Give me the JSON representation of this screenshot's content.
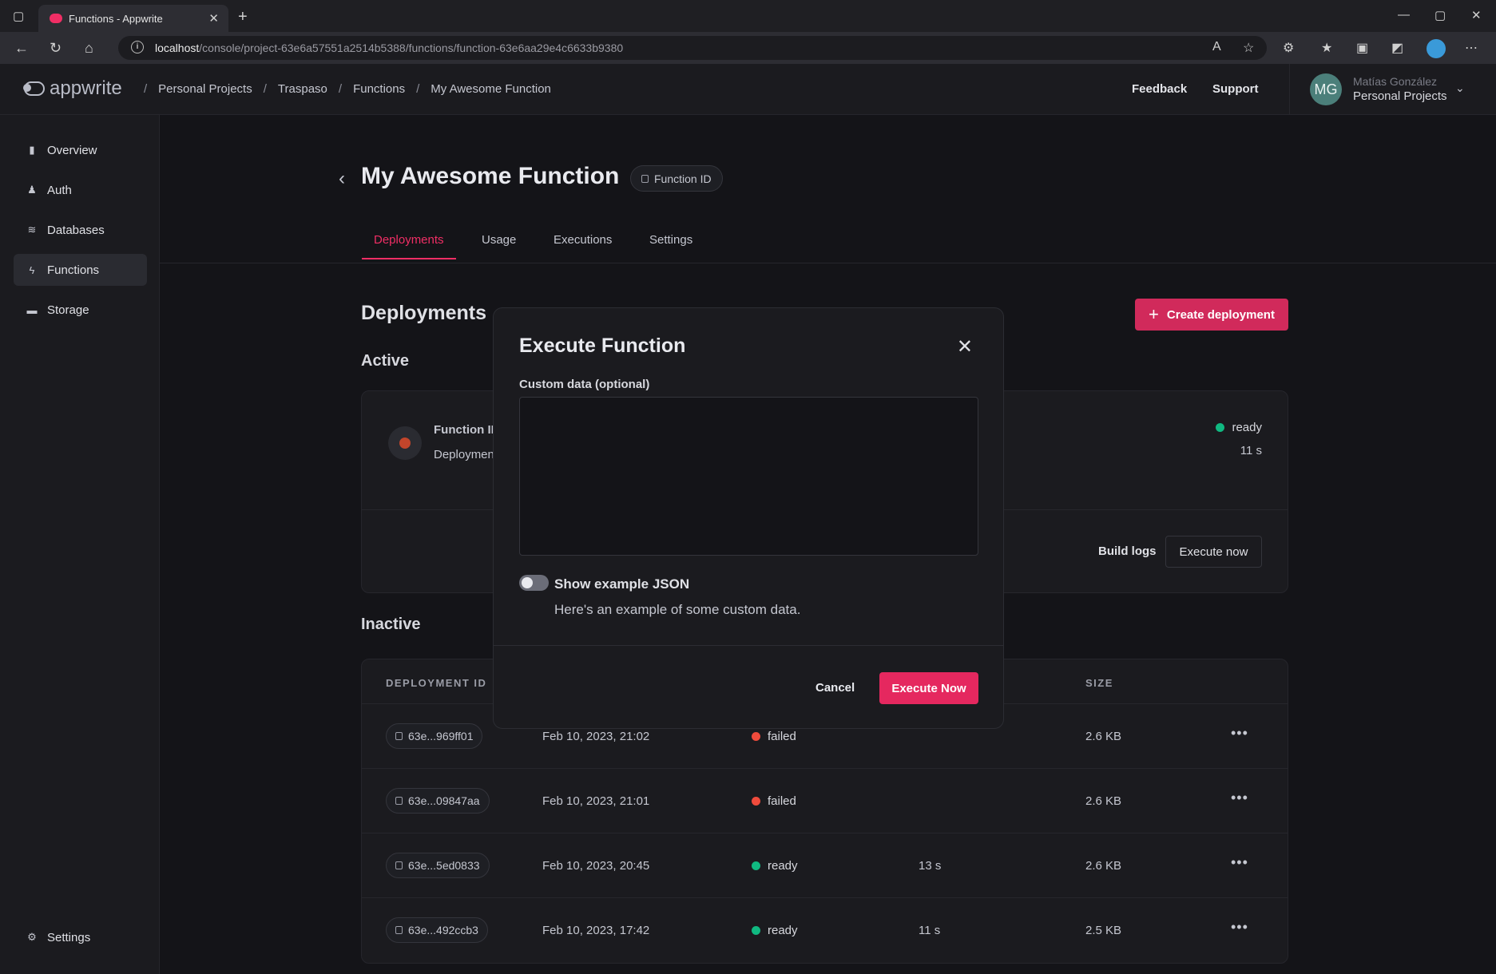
{
  "browser": {
    "tab_title": "Functions - Appwrite",
    "url_host": "localhost",
    "url_path": "/console/project-63e6a57551a2514b5388/functions/function-63e6aa29e4c6633b9380"
  },
  "header": {
    "logo": "appwrite",
    "breadcrumb": [
      "Personal Projects",
      "Traspaso",
      "Functions",
      "My Awesome Function"
    ],
    "feedback": "Feedback",
    "support": "Support",
    "user_initials": "MG",
    "user_name": "Matías González",
    "user_org": "Personal Projects"
  },
  "sidebar": {
    "items": [
      {
        "label": "Overview",
        "icon": "bar-chart-icon"
      },
      {
        "label": "Auth",
        "icon": "users-icon"
      },
      {
        "label": "Databases",
        "icon": "database-icon"
      },
      {
        "label": "Functions",
        "icon": "lightning-icon",
        "active": true
      },
      {
        "label": "Storage",
        "icon": "folder-icon"
      }
    ],
    "settings_label": "Settings"
  },
  "page": {
    "title": "My Awesome Function",
    "id_label": "Function ID",
    "tabs": [
      "Deployments",
      "Usage",
      "Executions",
      "Settings"
    ],
    "section_title": "Deployments",
    "create_button": "Create deployment"
  },
  "active": {
    "title": "Active",
    "function_id_label": "Function ID",
    "deployment_label": "Deploymen",
    "status": "ready",
    "duration": "11 s",
    "build_logs": "Build logs",
    "execute_now": "Execute now"
  },
  "inactive": {
    "title": "Inactive",
    "columns": [
      "DEPLOYMENT ID",
      "SIZE"
    ],
    "rows": [
      {
        "id": "63e...969ff01",
        "date": "Feb 10, 2023, 21:02",
        "status": "failed",
        "duration": "",
        "size": "2.6 KB"
      },
      {
        "id": "63e...09847aa",
        "date": "Feb 10, 2023, 21:01",
        "status": "failed",
        "duration": "",
        "size": "2.6 KB"
      },
      {
        "id": "63e...5ed0833",
        "date": "Feb 10, 2023, 20:45",
        "status": "ready",
        "duration": "13 s",
        "size": "2.6 KB"
      },
      {
        "id": "63e...492ccb3",
        "date": "Feb 10, 2023, 17:42",
        "status": "ready",
        "duration": "11 s",
        "size": "2.5 KB"
      }
    ]
  },
  "colors": {
    "accent": "#f02e65",
    "ready": "#10b981",
    "failed": "#f04b3c"
  },
  "modal": {
    "title": "Execute Function",
    "field_label": "Custom data (optional)",
    "custom_data": "",
    "toggle_label": "Show example JSON",
    "toggle_desc": "Here's an example of some custom data.",
    "cancel": "Cancel",
    "execute": "Execute Now"
  }
}
